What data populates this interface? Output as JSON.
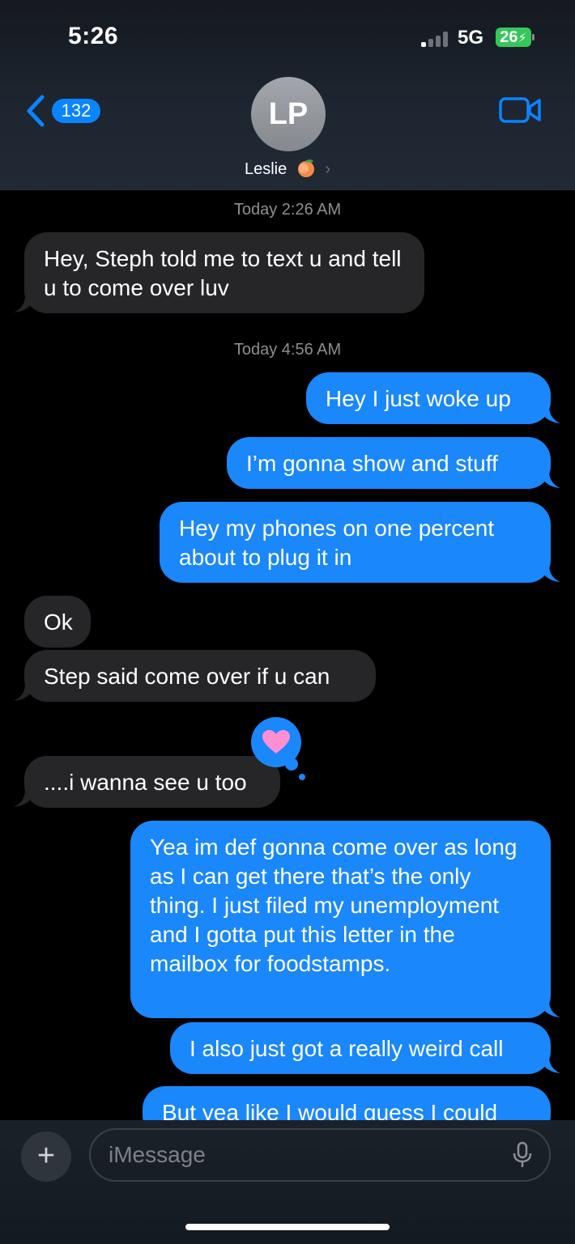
{
  "status": {
    "time": "5:26",
    "network": "5G",
    "battery": "26"
  },
  "header": {
    "back_count": "132",
    "avatar_initials": "LP",
    "contact_name": "Leslie"
  },
  "thread": {
    "timestamp_1": "Today 2:26 AM",
    "msg_1": "Hey, Steph told me to text u and tell u to come over luv",
    "timestamp_2": "Today 4:56 AM",
    "msg_2": "Hey I just woke up",
    "msg_3": "I’m gonna show and stuff",
    "msg_4": "Hey my phones on one percent about to plug it in",
    "msg_5": "Ok",
    "msg_6": "Step said come over if u can",
    "msg_7": "....i wanna see u too",
    "msg_7_reaction": "heart",
    "msg_8": "Yea im def gonna come over as long as I can get there that’s the only thing. I just filed my unemployment and I gotta put this letter in the mailbox for foodstamps.",
    "msg_9": "I also just got a really weird call",
    "msg_10": "But yea like I would guess I could"
  },
  "composer": {
    "placeholder": "iMessage"
  },
  "colors": {
    "outgoing": "#1a87fb",
    "incoming": "#262628",
    "accent": "#0a84ff"
  }
}
